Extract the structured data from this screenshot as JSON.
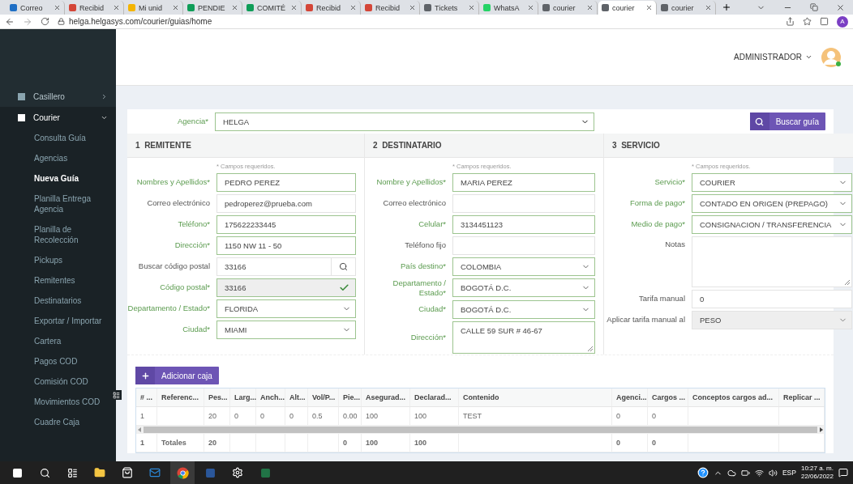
{
  "browser": {
    "tabs": [
      {
        "label": "Correo",
        "color": "#1f6fc5",
        "selected": false
      },
      {
        "label": "Recibid",
        "color": "#d44638",
        "selected": false
      },
      {
        "label": "Mi unid",
        "color": "#f4b400",
        "selected": false
      },
      {
        "label": "PENDIE",
        "color": "#0f9d58",
        "selected": false
      },
      {
        "label": "COMITÉ",
        "color": "#0f9d58",
        "selected": false
      },
      {
        "label": "Recibid",
        "color": "#d44638",
        "selected": false
      },
      {
        "label": "Recibid",
        "color": "#d44638",
        "selected": false
      },
      {
        "label": "Tickets",
        "color": "#5f6368",
        "selected": false
      },
      {
        "label": "WhatsA",
        "color": "#25d366",
        "selected": false
      },
      {
        "label": "courier",
        "color": "#5f6368",
        "selected": false
      },
      {
        "label": "courier",
        "color": "#5f6368",
        "selected": true
      },
      {
        "label": "courier",
        "color": "#5f6368",
        "selected": false
      }
    ],
    "url": "helga.helgasys.com/courier/guias/home",
    "profile": "A"
  },
  "header": {
    "user": "ADMINISTRADOR"
  },
  "sidebar": {
    "items": [
      {
        "label": "Casillero",
        "expanded": false
      },
      {
        "label": "Courier",
        "expanded": true,
        "children": [
          {
            "label": "Consulta Guía",
            "selected": false
          },
          {
            "label": "Agencias",
            "selected": false
          },
          {
            "label": "Nueva Guía",
            "selected": true
          },
          {
            "label": "Planilla Entrega Agencia",
            "selected": false
          },
          {
            "label": "Planilla de Recolección",
            "selected": false
          },
          {
            "label": "Pickups",
            "selected": false
          },
          {
            "label": "Remitentes",
            "selected": false
          },
          {
            "label": "Destinatarios",
            "selected": false
          },
          {
            "label": "Exportar / Importar",
            "selected": false
          },
          {
            "label": "Cartera",
            "selected": false
          },
          {
            "label": "Pagos COD",
            "selected": false
          },
          {
            "label": "Comisión COD",
            "selected": false
          },
          {
            "label": "Movimientos COD",
            "selected": false
          },
          {
            "label": "Cuadre Caja",
            "selected": false
          }
        ]
      }
    ]
  },
  "form": {
    "agency": {
      "label": "Agencia*",
      "value": "HELGA",
      "required": true
    },
    "search_button": "Buscar guía",
    "sections": [
      {
        "number": "1",
        "title": "REMITENTE",
        "note": "* Campos requeridos.",
        "fields": [
          {
            "label": "Nombres y Apellidos*",
            "kind": "text",
            "value": "PEDRO PEREZ",
            "required": true
          },
          {
            "label": "Correo electrónico",
            "kind": "text",
            "value": "pedroperez@prueba.com",
            "required": false
          },
          {
            "label": "Teléfono*",
            "kind": "text",
            "value": "175622233445",
            "required": true
          },
          {
            "label": "Dirección*",
            "kind": "text",
            "value": "1150 NW 11 - 50",
            "required": true
          },
          {
            "label": "Buscar código postal",
            "kind": "search",
            "value": "33166",
            "required": false
          },
          {
            "label": "Código postal*",
            "kind": "verified",
            "value": "33166",
            "required": true
          },
          {
            "label": "Departamento / Estado*",
            "kind": "select",
            "value": "FLORIDA",
            "required": true
          },
          {
            "label": "Ciudad*",
            "kind": "select",
            "value": "MIAMI",
            "required": true
          }
        ]
      },
      {
        "number": "2",
        "title": "DESTINATARIO",
        "note": "* Campos requeridos.",
        "fields": [
          {
            "label": "Nombre y Apellidos*",
            "kind": "text",
            "value": "MARIA PEREZ",
            "required": true
          },
          {
            "label": "Correo electrónico",
            "kind": "text",
            "required": false
          },
          {
            "label": "Celular*",
            "kind": "text",
            "value": "3134451123",
            "required": true
          },
          {
            "label": "Teléfono fijo",
            "kind": "text",
            "required": false
          },
          {
            "label": "País destino*",
            "kind": "select",
            "value": "COLOMBIA",
            "required": true
          },
          {
            "label": "Departamento / Estado*",
            "kind": "select",
            "value": "BOGOTÁ D.C.",
            "required": true
          },
          {
            "label": "Ciudad*",
            "kind": "select",
            "value": "BOGOTÁ D.C.",
            "required": true
          },
          {
            "label": "Dirección*",
            "kind": "textarea",
            "value": "CALLE 59 SUR # 46-67",
            "required": true
          }
        ]
      },
      {
        "number": "3",
        "title": "SERVICIO",
        "note": "* Campos requeridos.",
        "fields": [
          {
            "label": "Servicio*",
            "kind": "select",
            "value": "COURIER",
            "required": true
          },
          {
            "label": "Forma de pago*",
            "kind": "select",
            "value": "CONTADO EN ORIGEN (PREPAGO)",
            "required": true
          },
          {
            "label": "Medio de pago*",
            "kind": "select",
            "value": "CONSIGNACION / TRANSFERENCIA",
            "required": true
          },
          {
            "label": "Notas",
            "kind": "notes",
            "required": false
          },
          {
            "label": "Tarifa manual",
            "kind": "text",
            "value": "0",
            "required": false
          },
          {
            "label": "Aplicar tarifa manual al",
            "kind": "select",
            "value": "PESO",
            "required": false,
            "disabled": true
          }
        ]
      }
    ]
  },
  "boxes": {
    "add_button": "Adicionar caja",
    "columns": [
      {
        "label": "# ...",
        "value": "1",
        "total": "1"
      },
      {
        "label": "Referenc...",
        "total": "Totales"
      },
      {
        "label": "Pes...",
        "value": "20",
        "total": "20"
      },
      {
        "label": "Larg...",
        "value": "0"
      },
      {
        "label": "Anch...",
        "value": "0"
      },
      {
        "label": "Alt...",
        "value": "0"
      },
      {
        "label": "Vol/P...",
        "value": "0.5"
      },
      {
        "label": "Pie...",
        "value": "0.00",
        "total": "0"
      },
      {
        "label": "Asegurad...",
        "value": "100",
        "total": "100"
      },
      {
        "label": "Declarad...",
        "value": "100",
        "total": "100"
      },
      {
        "label": "Contenido",
        "value": "TEST"
      },
      {
        "label": "Agenci...",
        "value": "0",
        "total": "0"
      },
      {
        "label": "Cargos ...",
        "value": "0",
        "total": "0"
      },
      {
        "label": "Conceptos cargos ad..."
      },
      {
        "label": "Replicar ..."
      }
    ]
  },
  "taskbar": {
    "language": "ESP",
    "time": "10:27 a. m.",
    "date": "22/06/2022"
  }
}
